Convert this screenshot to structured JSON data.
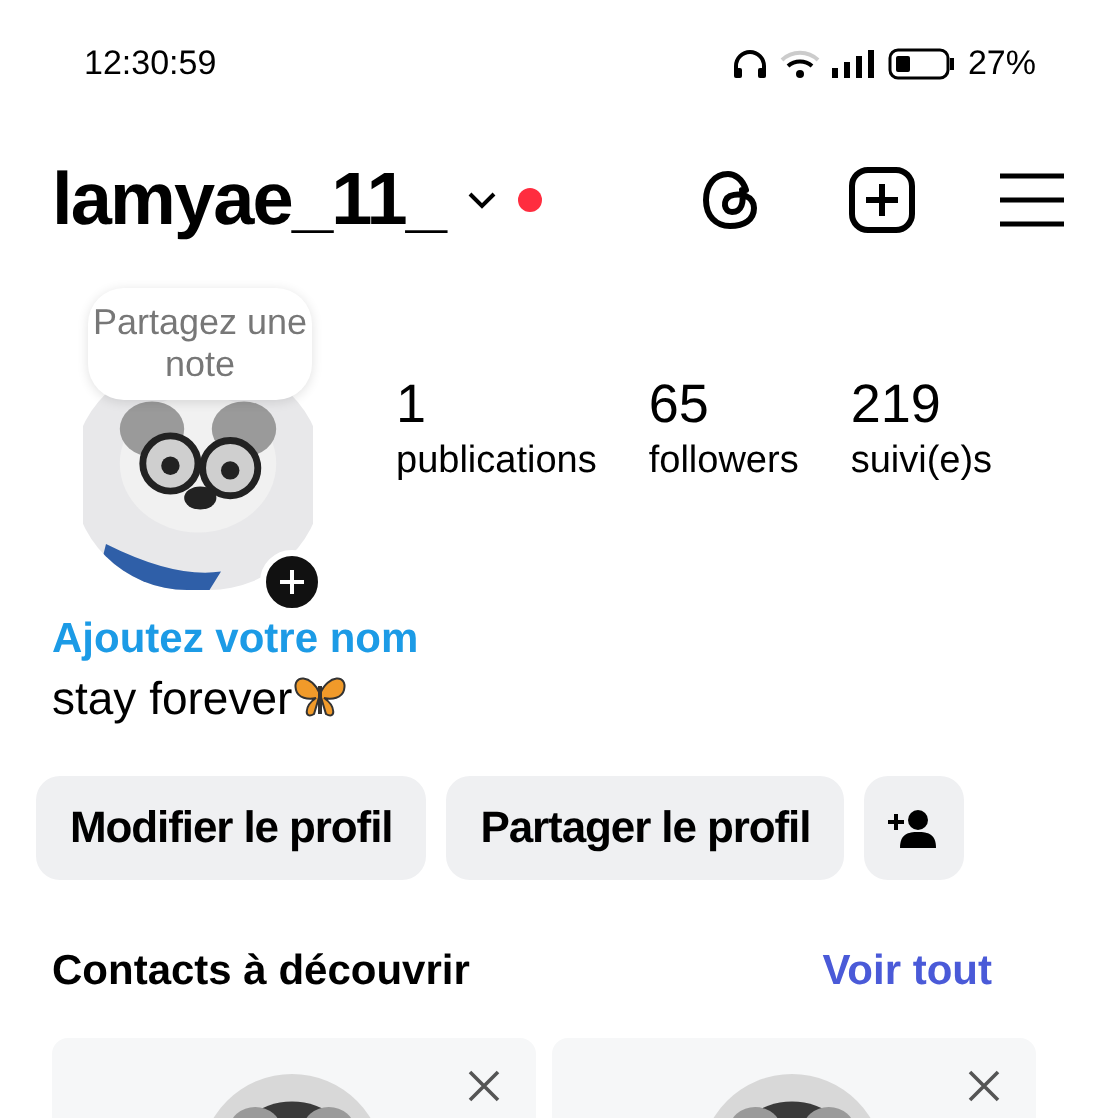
{
  "status_bar": {
    "time": "12:30:59",
    "battery": "27%"
  },
  "header": {
    "username": "lamyae_11_",
    "unread": true
  },
  "profile": {
    "note": "Partagez une note",
    "stats": [
      {
        "value": "1",
        "label": "publications"
      },
      {
        "value": "65",
        "label": "followers"
      },
      {
        "value": "219",
        "label": "suivi(e)s"
      }
    ],
    "name_prompt": "Ajoutez votre nom",
    "bio": "stay forever"
  },
  "buttons": [
    "Modifier le profil",
    "Partager le profil"
  ],
  "suggestions": {
    "title": "Contacts à découvrir",
    "link": "Voir tout"
  }
}
